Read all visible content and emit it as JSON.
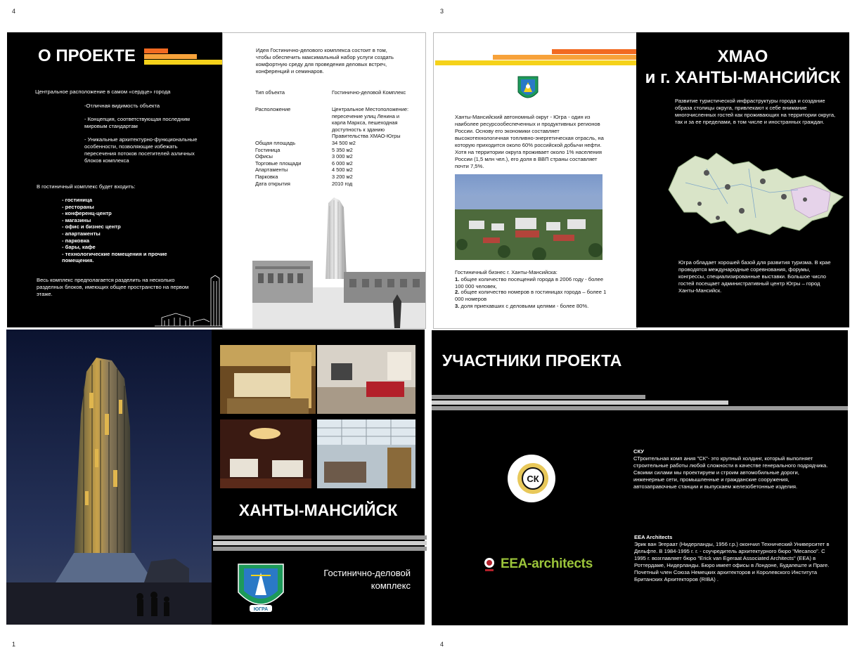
{
  "page_numbers": {
    "top_left": "4",
    "top_right": "3",
    "bottom_left": "1",
    "bottom_right": "4"
  },
  "about": {
    "title": "О ПРОЕКТЕ",
    "intro": "Центральное расположение в самом «сердце» города",
    "points": [
      "-Отличная видимость объекта",
      "- Концепция, соответствующая   последним мировым  стандартам",
      "- Уникальные архитектурно-функциональные особенности, позволяющие избежать пересечения потоков посетителей азличных блоков комплекса"
    ],
    "includes_title": "В гостиничный комплекс будет входить:",
    "includes": [
      "- гостиница",
      "- рестораны",
      "- конференц-центр",
      "- магазины",
      "- офис и бизнес центр",
      "- апартаменты",
      "- парковка",
      "- бары, кафе",
      "- технологические помещения и прочие помещения."
    ],
    "footer": "Весь комплекс предполагается разделить на несколько разделных блоков, имеющих общее пространство на первом этаже."
  },
  "idea": {
    "text": "Идея Гостинично-делового комплекса состоит в том, чтобы обеспечить максимальный набор услуги создать комфортную среду для проведения деловых встреч, конференций и семинаров.",
    "rows": [
      {
        "label": "Тип объекта",
        "value": "Гостинично-деловой Комплекс"
      },
      {
        "label": "Расположение",
        "value": "Центральное Местоположение: пересечение улиц Ленина и карла        Маркса, пешеходная доступность к зданию Правительства ХМАО-Югры"
      },
      {
        "label": "Общая площадь",
        "value": "34 500 м2"
      },
      {
        "label": "Гостиница",
        "value": "5 350 м2"
      },
      {
        "label": "Офисы",
        "value": "3 000 м2"
      },
      {
        "label": "Торговые площади",
        "value": "6 000 м2"
      },
      {
        "label": "Апартаменты",
        "value": "4 500 м2"
      },
      {
        "label": "Парковка",
        "value": "3 200 м2"
      },
      {
        "label": "Дата открытия",
        "value": "2010 год"
      }
    ]
  },
  "okrug": {
    "text": "Ханты-Мансийский автономный округ - Югра - один из наиболее ресурсообеспеченных и продуктивных регионов России. Основу его экономики составляет высокотехнологичная топливно-энергетическая отрасль, на которую приходится около 60% российской добычи нефти. Хотя на территории округа проживает около 1% населения России (1,5 млн чел.), его доля в ВВП страны составляет почти 7,5%.",
    "stats_title": "Гостиничный бизнес г. Ханты-Мансийска:",
    "stats": [
      {
        "num": "1.",
        "text": " общее количество посещений города в 2006 году - более 100 000 человек,"
      },
      {
        "num": "2.",
        "text": " общее количество номеров в гостиницах города – более 1 000 номеров"
      },
      {
        "num": "3.",
        "text": " доля приехавших с деловыми целями - более 80%."
      }
    ]
  },
  "hmao": {
    "title_line1": "ХМАО",
    "title_line2": "и г. ХАНТЫ-МАНСИЙСК",
    "text1": "Развитие туристической инфраструктуры города и создание образа столицы округа, привлекают к себе внимание многочисленных гостей как проживающих на территории округа, так и за ее пределами, в  том числе и иностранных граждан.",
    "text2": "Югра обладает хорошей базой для развития туризма. В крае проводятся международные соревнования, форумы, конгрессы, специализированные выставки. Большое число гостей посещает административный центр Югры – город Ханты-Мансийск."
  },
  "cover": {
    "city": "ХАНТЫ-МАНСИЙСК",
    "subtitle_line1": "Гостинично-деловой",
    "subtitle_line2": "комплекс",
    "emblem_text": "ЮГРА"
  },
  "participants": {
    "title": "УЧАСТНИКИ ПРОЕКТА",
    "sku_name": "СКУ",
    "sku_text": "СТроительная комп ания \"СК\"- это крупный холдинг, который выполняет строительные работы любой сложности в качестве генерального подрядчика.  Своими силами мы проектируем и строим автомобильные дороги, инженерные сети, промышленные и гражданские сооружения, автозаправочные станции и выпускаем железобетонные изделия.",
    "eea_name": "EEA Architects",
    "eea_text": "Эрик ван Эгераат (Нидерланды, 1956 г.р.) окончил Технический Университет в Дельфте. В 1984-1995 г. г. - соучредитель архитектурного бюро \"Mecanoo\". С 1995 г. возглавляет бюро \"Erick van Egeraat Associated Architects\" (EEA) в Роттердаме, Нидерланды. Бюро имеет офисы в Лондоне, Будапеште и Праге. Почетный член Союза Немецких архитекторов и Королевского Института Британских Архитекторов (RIBA) .",
    "eea_logo": "EEA-architects",
    "sku_logo_letter": "СК"
  },
  "colors": {
    "orange": "#f26a21",
    "light_orange": "#f7a23a",
    "yellow": "#f5d21a",
    "eea_green": "#9bc43a",
    "black": "#000000"
  }
}
